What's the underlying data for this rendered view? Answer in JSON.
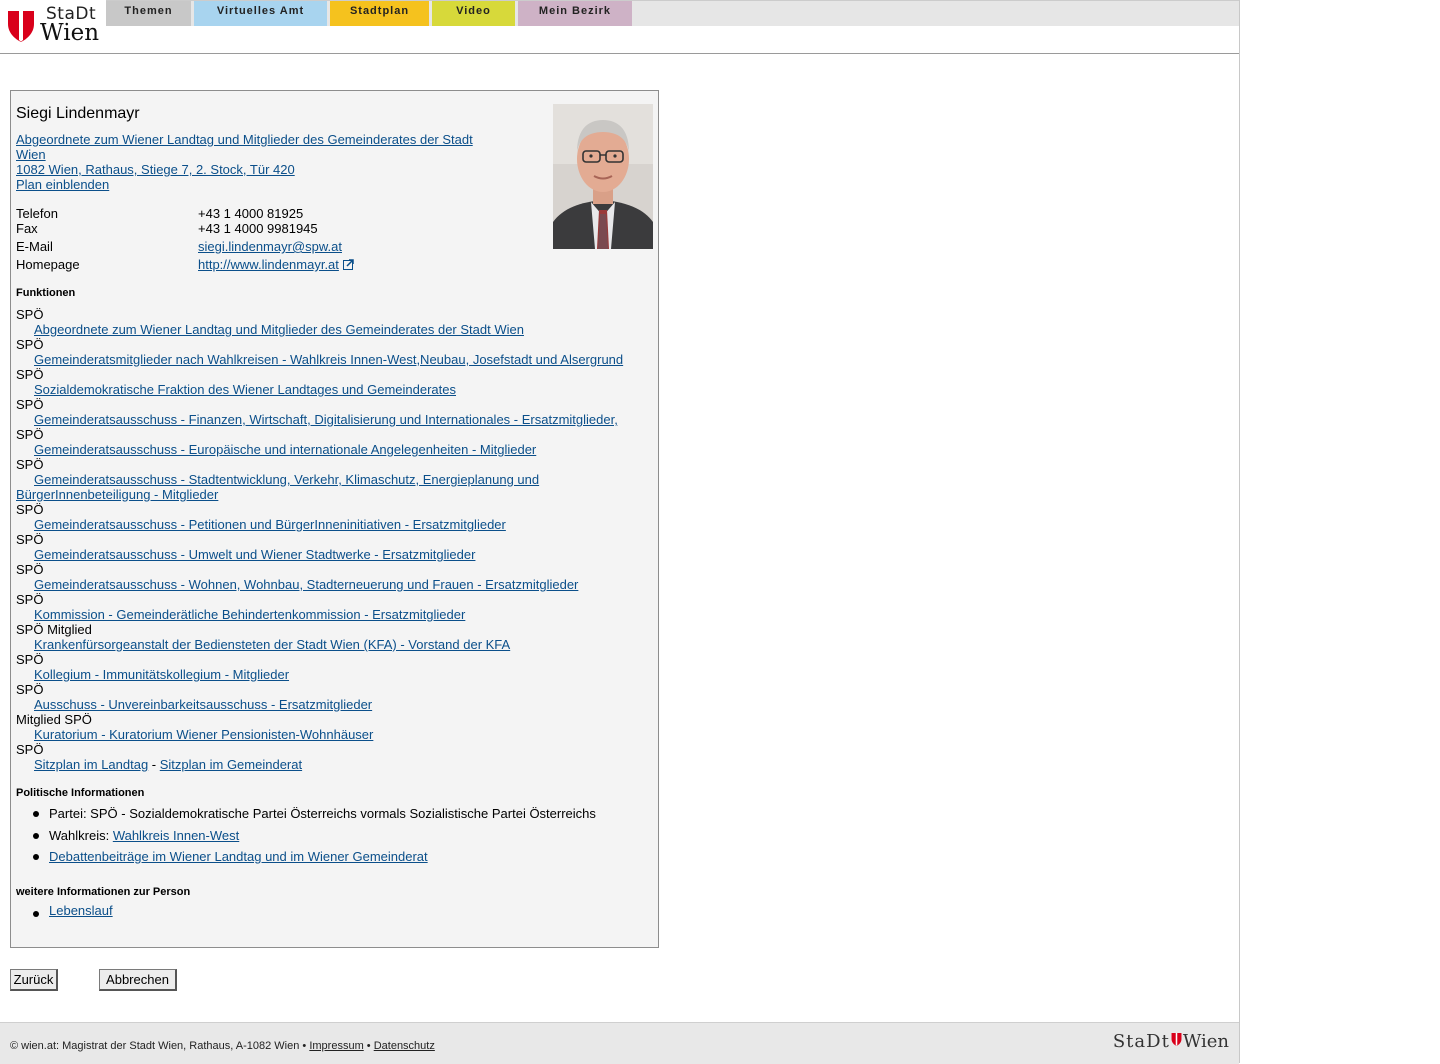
{
  "header": {
    "logo_line1": "StaDt",
    "logo_line2": "Wien",
    "tabs": [
      {
        "label": "Themen",
        "color": "#c8c8c8"
      },
      {
        "label": "Virtuelles Amt",
        "color": "#a8d4ef"
      },
      {
        "label": "Stadtplan",
        "color": "#f5c21e"
      },
      {
        "label": "Video",
        "color": "#d7d93a"
      },
      {
        "label": "Mein Bezirk",
        "color": "#ceb2c6"
      }
    ]
  },
  "person": {
    "name": "Siegi Lindenmayr",
    "role_link": "Abgeordnete zum Wiener Landtag und Mitglieder des Gemeinderates der Stadt Wien",
    "address_link": "1082 Wien, Rathaus, Stiege 7, 2. Stock, Tür 420",
    "plan_link": "Plan einblenden"
  },
  "contact": {
    "telefon_label": "Telefon",
    "telefon": "+43 1 4000 81925",
    "fax_label": "Fax",
    "fax": "+43 1 4000 9981945",
    "email_label": "E-Mail",
    "email": "siegi.lindenmayr@spw.at",
    "homepage_label": "Homepage",
    "homepage": "http://www.lindenmayr.at"
  },
  "funktionen": {
    "heading": "Funktionen",
    "items": [
      {
        "party": "SPÖ",
        "link": "Abgeordnete zum Wiener Landtag und Mitglieder des Gemeinderates der Stadt Wien"
      },
      {
        "party": "SPÖ",
        "link": "Gemeinderatsmitglieder nach Wahlkreisen - Wahlkreis Innen-West,Neubau, Josefstadt und Alsergrund"
      },
      {
        "party": "SPÖ",
        "link": "Sozialdemokratische Fraktion des Wiener Landtages und Gemeinderates"
      },
      {
        "party": "SPÖ",
        "link": "Gemeinderatsausschuss - Finanzen, Wirtschaft, Digitalisierung und Internationales - Ersatzmitglieder, "
      },
      {
        "party": "SPÖ",
        "link": "Gemeinderatsausschuss - Europäische und internationale Angelegenheiten - Mitglieder"
      },
      {
        "party": "SPÖ",
        "link": "Gemeinderatsausschuss - Stadtentwicklung, Verkehr, Klimaschutz, Energieplanung und BürgerInnenbeteiligung - Mitglieder"
      },
      {
        "party": "SPÖ",
        "link": "Gemeinderatsausschuss - Petitionen und BürgerInneninitiativen - Ersatzmitglieder"
      },
      {
        "party": "SPÖ",
        "link": "Gemeinderatsausschuss - Umwelt und Wiener Stadtwerke - Ersatzmitglieder"
      },
      {
        "party": "SPÖ",
        "link": "Gemeinderatsausschuss - Wohnen, Wohnbau, Stadterneuerung und Frauen - Ersatzmitglieder"
      },
      {
        "party": "SPÖ",
        "link": "Kommission - Gemeinderätliche Behindertenkommission - Ersatzmitglieder"
      },
      {
        "party": "SPÖ Mitglied",
        "link": "Krankenfürsorgeanstalt der Bediensteten der Stadt Wien (KFA) - Vorstand der KFA"
      },
      {
        "party": "SPÖ",
        "link": "Kollegium - Immunitätskollegium - Mitglieder"
      },
      {
        "party": "SPÖ",
        "link": "Ausschuss - Unvereinbarkeitsausschuss - Ersatzmitglieder"
      },
      {
        "party": "Mitglied SPÖ",
        "link": "Kuratorium - Kuratorium Wiener Pensionisten-Wohnhäuser"
      }
    ],
    "last_party": "SPÖ",
    "sitzplan_landtag": "Sitzplan im Landtag",
    "sitzplan_sep": " - ",
    "sitzplan_gemeinderat": "Sitzplan im Gemeinderat"
  },
  "politisch": {
    "heading": "Politische Informationen",
    "partei": "Partei: SPÖ - Sozialdemokratische Partei Österreichs vormals Sozialistische Partei Österreichs",
    "wahlkreis_label": "Wahlkreis: ",
    "wahlkreis_link": "Wahlkreis Innen-West",
    "debatten_link": "Debattenbeiträge im Wiener Landtag und im Wiener Gemeinderat"
  },
  "weitere": {
    "heading": "weitere Informationen zur Person",
    "lebenslauf": "Lebenslauf"
  },
  "buttons": {
    "back": "Zurück",
    "cancel": "Abbrechen"
  },
  "footer": {
    "text": "© wien.at: Magistrat der Stadt Wien, Rathaus, A-1082 Wien •",
    "impressum": "Impressum",
    "sep": " • ",
    "datenschutz": "Datenschutz",
    "logo_left": "StaDt",
    "logo_right": "Wien"
  }
}
